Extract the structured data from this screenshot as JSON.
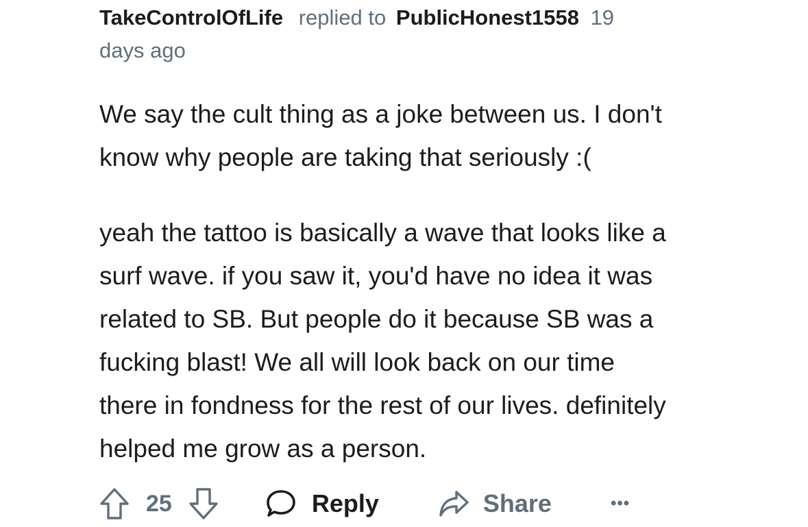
{
  "comment": {
    "author": "TakeControlOfLife",
    "replied_to_text": "replied to",
    "replied_to_user": "PublicHonest1558",
    "age_line1": "19",
    "age_line2": "days ago",
    "paragraph1": [
      "We say the cult thing as a joke between us. I don't",
      "know why people are taking that seriously :("
    ],
    "paragraph2": [
      "yeah the tattoo is basically a wave that looks like a",
      "surf wave. if you saw it, you'd have no idea it was",
      "related to SB. But people do it because SB was a",
      "fucking blast! We all will look back on our time",
      "there in fondness for the rest of our lives. definitely",
      "helped me grow as a person."
    ]
  },
  "actions": {
    "upvote_icon": "arrow-up-icon",
    "vote_count": "25",
    "downvote_icon": "arrow-down-icon",
    "reply_icon": "speech-bubble-icon",
    "reply_label": "Reply",
    "share_icon": "share-arrow-icon",
    "share_label": "Share",
    "more_label": "•••"
  },
  "colors": {
    "text_primary": "#1c1c1c",
    "text_secondary": "#5f6f7c",
    "background": "#ffffff"
  }
}
